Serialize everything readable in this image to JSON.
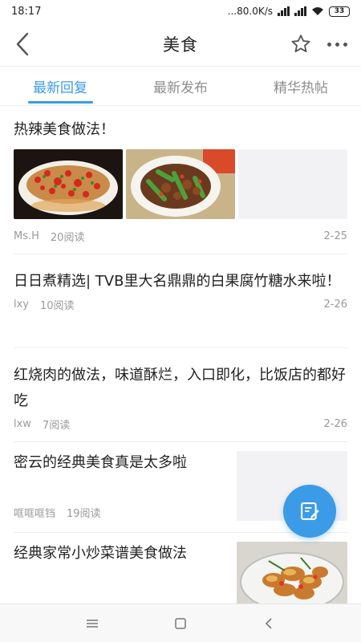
{
  "status": {
    "time": "18:17",
    "net_speed": "...80.0K/s",
    "battery": "33"
  },
  "header": {
    "title": "美食"
  },
  "tabs": [
    {
      "label": "最新回复",
      "active": true
    },
    {
      "label": "最新发布",
      "active": false
    },
    {
      "label": "精华热帖",
      "active": false
    }
  ],
  "posts": [
    {
      "title": "热辣美食做法！",
      "author": "Ms.H",
      "reads": "20阅读",
      "date": "2-25"
    },
    {
      "title": "日日煮精选| TVB里大名鼎鼎的白果腐竹糖水来啦！",
      "author": "lxy",
      "reads": "10阅读",
      "date": "2-26"
    },
    {
      "title": "红烧肉的做法，味道酥烂，入口即化，比饭店的都好吃",
      "author": "lxw",
      "reads": "7阅读",
      "date": "2-26"
    },
    {
      "title": "密云的经典美食真是太多啦",
      "author": "哐哐哐铛",
      "reads": "19阅读",
      "date": ""
    },
    {
      "title": "经典家常小炒菜谱美食做法",
      "author": "",
      "reads": "",
      "date": ""
    }
  ],
  "colors": {
    "accent": "#3c9be6",
    "text": "#222222",
    "muted": "#999999"
  }
}
